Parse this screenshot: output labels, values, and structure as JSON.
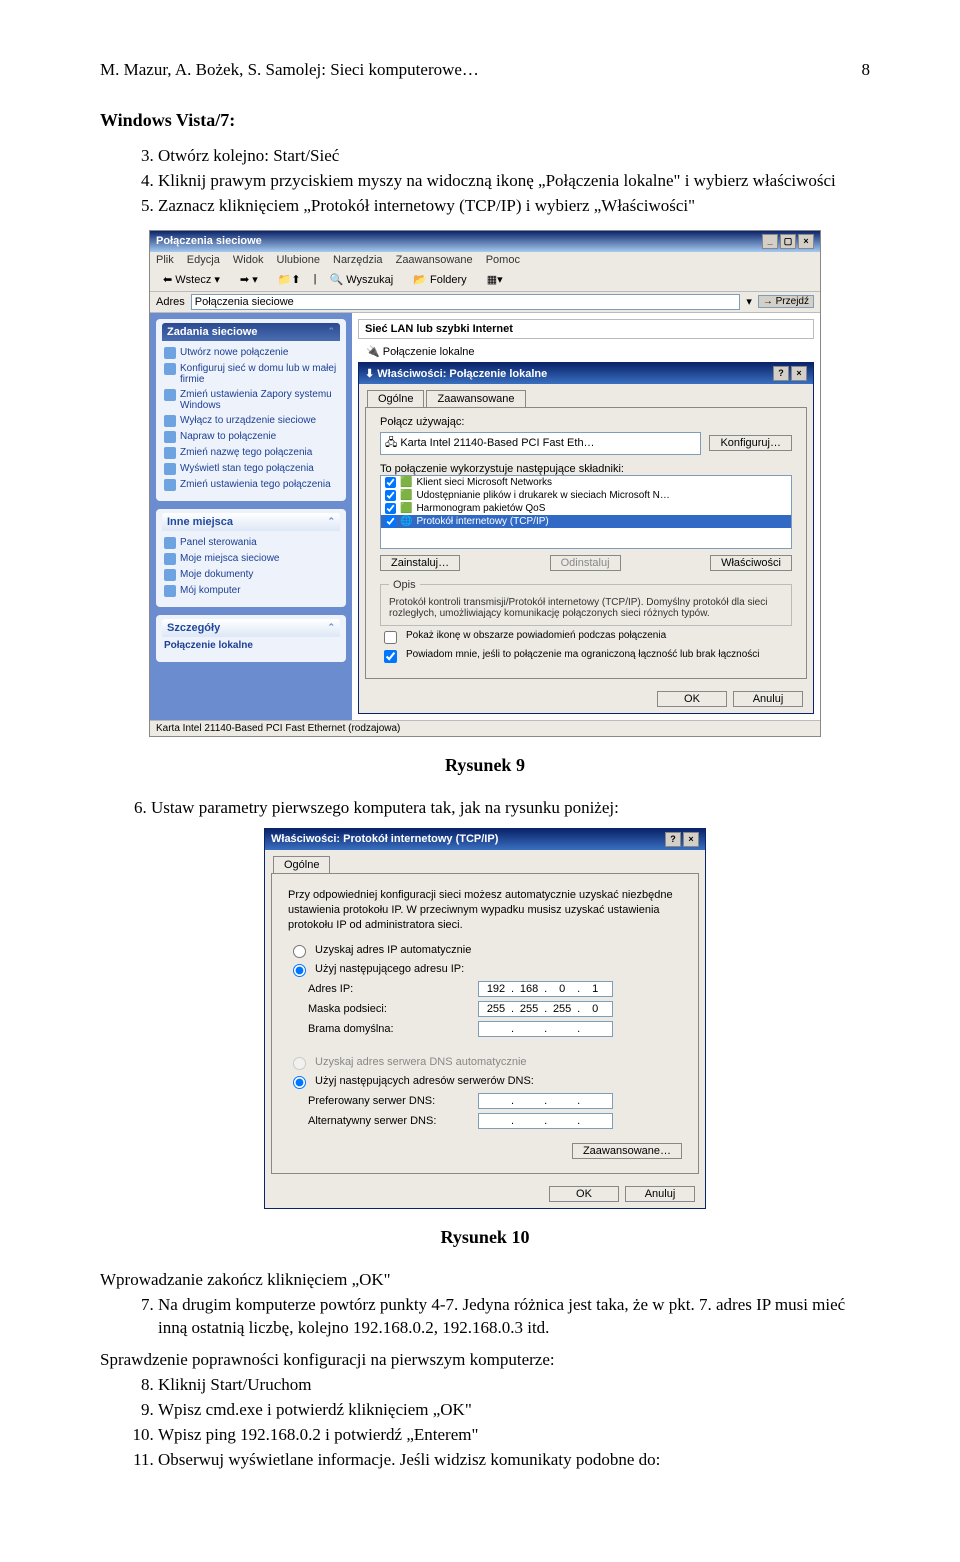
{
  "header": {
    "author_line": "M. Mazur, A. Bożek, S. Samolej: Sieci komputerowe…",
    "page_number": "8"
  },
  "section": {
    "os_heading": "Windows Vista/7:",
    "list1_start": 3,
    "list1": [
      "Otwórz kolejno: Start/Sieć",
      "Kliknij prawym przyciskiem myszy na widoczną ikonę „Połączenia lokalne\" i wybierz właściwości",
      "Zaznacz kliknięciem „Protokół internetowy (TCP/IP) i wybierz „Właściwości\""
    ],
    "fig1_caption": "Rysunek 9",
    "step6_num": "6.",
    "step6": "Ustaw parametry pierwszego komputera tak, jak na rysunku poniżej:",
    "fig2_caption": "Rysunek 10",
    "after_text": "Wprowadzanie zakończ kliknięciem „OK\"",
    "list2_start": 7,
    "list2": [
      "Na drugim komputerze powtórz punkty 4-7. Jedyna różnica jest taka, że w pkt. 7. adres IP musi mieć inną ostatnią liczbę, kolejno 192.168.0.2, 192.168.0.3 itd."
    ],
    "sprawdzenie": "Sprawdzenie poprawności konfiguracji na pierwszym komputerze:",
    "list3_start": 8,
    "list3": [
      "Kliknij Start/Uruchom",
      "Wpisz cmd.exe i potwierdź kliknięciem „OK\"",
      "Wpisz ping 192.168.0.2 i potwierdź „Enterem\"",
      "Obserwuj wyświetlane informacje. Jeśli widzisz komunikaty podobne do:"
    ]
  },
  "win1": {
    "title": "Połączenia sieciowe",
    "menu": [
      "Plik",
      "Edycja",
      "Widok",
      "Ulubione",
      "Narzędzia",
      "Zaawansowane",
      "Pomoc"
    ],
    "toolbar": {
      "back": "Wstecz",
      "search": "Wyszukaj",
      "folders": "Foldery"
    },
    "address_label": "Adres",
    "address_value": "Połączenia sieciowe",
    "go_label": "Przejdź",
    "tasks_panel_title": "Zadania sieciowe",
    "tasks_items": [
      "Utwórz nowe połączenie",
      "Konfiguruj sieć w domu lub w małej firmie",
      "Zmień ustawienia Zapory systemu Windows",
      "Wyłącz to urządzenie sieciowe",
      "Napraw to połączenie",
      "Zmień nazwę tego połączenia",
      "Wyświetl stan tego połączenia",
      "Zmień ustawienia tego połączenia"
    ],
    "other_panel_title": "Inne miejsca",
    "other_items": [
      "Panel sterowania",
      "Moje miejsca sieciowe",
      "Moje dokumenty",
      "Mój komputer"
    ],
    "details_panel_title": "Szczegóły",
    "details_line": "Połączenie lokalne",
    "group_lan": "Sieć LAN lub szybki Internet",
    "conn_name": "Połączenie lokalne",
    "statusbar": "Karta Intel 21140-Based PCI Fast Ethernet (rodzajowa)",
    "dlg": {
      "title": "Właściwości: Połączenie lokalne",
      "tabs": [
        "Ogólne",
        "Zaawansowane"
      ],
      "connect_using": "Połącz używając:",
      "adapter": "Karta Intel 21140-Based PCI Fast Eth…",
      "config_btn": "Konfiguruj…",
      "uses_label": "To połączenie wykorzystuje następujące składniki:",
      "components": [
        {
          "label": "Klient sieci Microsoft Networks",
          "checked": true,
          "sel": false
        },
        {
          "label": "Udostępnianie plików i drukarek w sieciach Microsoft N…",
          "checked": true,
          "sel": false
        },
        {
          "label": "Harmonogram pakietów QoS",
          "checked": true,
          "sel": false
        },
        {
          "label": "Protokół internetowy (TCP/IP)",
          "checked": true,
          "sel": true
        }
      ],
      "install_btn": "Zainstaluj…",
      "uninstall_btn": "Odinstaluj",
      "props_btn": "Właściwości",
      "desc_title": "Opis",
      "desc_text": "Protokół kontroli transmisji/Protokół internetowy (TCP/IP). Domyślny protokół dla sieci rozległych, umożliwiający komunikację połączonych sieci różnych typów.",
      "chk1": "Pokaż ikonę w obszarze powiadomień podczas połączenia",
      "chk2": "Powiadom mnie, jeśli to połączenie ma ograniczoną łączność lub brak łączności",
      "ok": "OK",
      "cancel": "Anuluj"
    }
  },
  "win2": {
    "title": "Właściwości: Protokół internetowy (TCP/IP)",
    "tab": "Ogólne",
    "desc": "Przy odpowiedniej konfiguracji sieci możesz automatycznie uzyskać niezbędne ustawienia protokołu IP. W przeciwnym wypadku musisz uzyskać ustawienia protokołu IP od administratora sieci.",
    "r1": "Uzyskaj adres IP automatycznie",
    "r2": "Użyj następującego adresu IP:",
    "ip_label": "Adres IP:",
    "ip": [
      "192",
      "168",
      "0",
      "1"
    ],
    "mask_label": "Maska podsieci:",
    "mask": [
      "255",
      "255",
      "255",
      "0"
    ],
    "gw_label": "Brama domyślna:",
    "gw": [
      "",
      "",
      "",
      ""
    ],
    "r3": "Uzyskaj adres serwera DNS automatycznie",
    "r4": "Użyj następujących adresów serwerów DNS:",
    "dns1_label": "Preferowany serwer DNS:",
    "dns2_label": "Alternatywny serwer DNS:",
    "adv_btn": "Zaawansowane…",
    "ok": "OK",
    "cancel": "Anuluj"
  }
}
